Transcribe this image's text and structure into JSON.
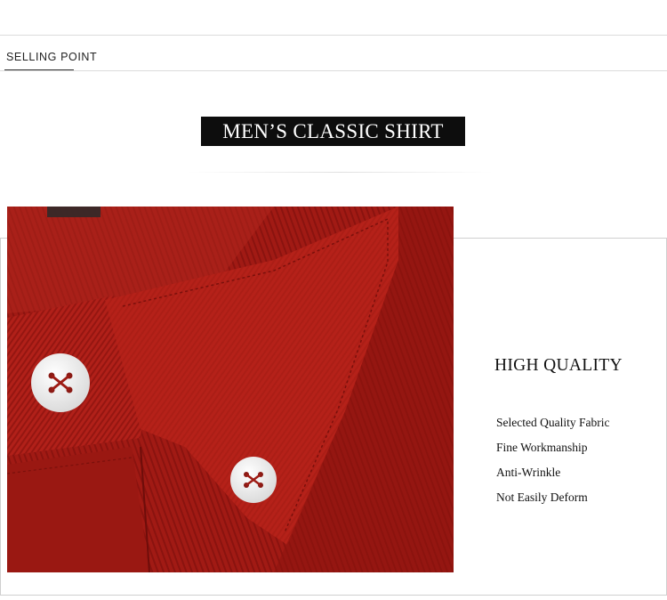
{
  "tab": {
    "label": "SELLING POINT"
  },
  "banner": {
    "title": "MEN’S CLASSIC SHIRT"
  },
  "product": {
    "image_alt": "Close-up of red corduroy shirt collar with white buttons",
    "colors": {
      "fabric": "#a61b15",
      "button": "#f2f2f2"
    }
  },
  "quality": {
    "title": "HIGH QUALITY",
    "features": [
      "Selected Quality Fabric",
      "Fine Workmanship",
      "Anti-Wrinkle",
      "Not Easily Deform"
    ]
  }
}
